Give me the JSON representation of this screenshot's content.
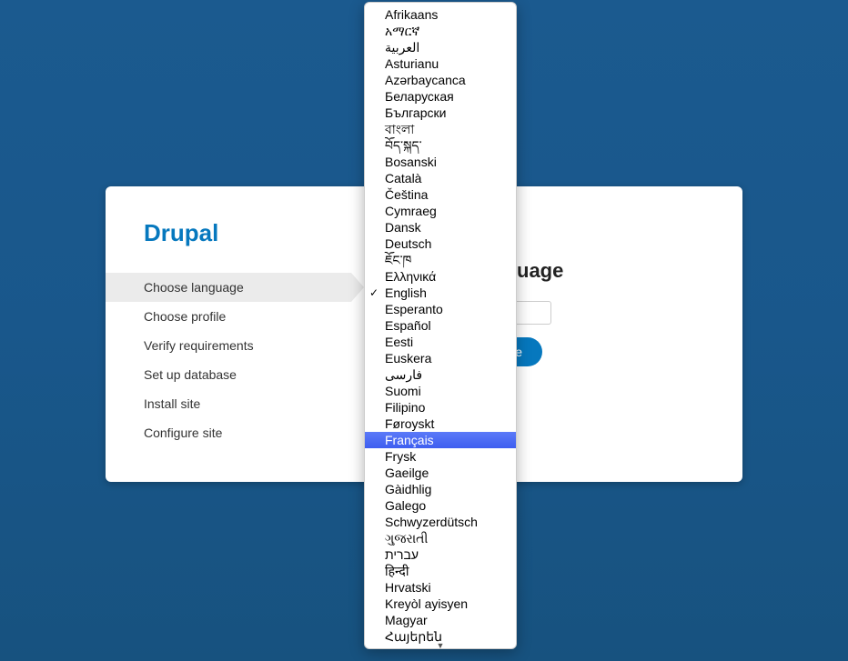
{
  "brand": "Drupal",
  "heading": "Choose language",
  "button_label": "Save and continue",
  "steps": [
    {
      "label": "Choose language",
      "active": true
    },
    {
      "label": "Choose profile",
      "active": false
    },
    {
      "label": "Verify requirements",
      "active": false
    },
    {
      "label": "Set up database",
      "active": false
    },
    {
      "label": "Install site",
      "active": false
    },
    {
      "label": "Configure site",
      "active": false
    }
  ],
  "dropdown": {
    "selected": "English",
    "highlighted": "Français",
    "options": [
      "Afrikaans",
      "አማርኛ",
      "العربية",
      "Asturianu",
      "Azərbaycanca",
      "Беларуская",
      "Български",
      "বাংলা",
      "བོད་སྐད་",
      "Bosanski",
      "Català",
      "Čeština",
      "Cymraeg",
      "Dansk",
      "Deutsch",
      "ཇོང་ཁ",
      "Ελληνικά",
      "English",
      "Esperanto",
      "Español",
      "Eesti",
      "Euskera",
      "فارسی",
      "Suomi",
      "Filipino",
      "Føroyskt",
      "Français",
      "Frysk",
      "Gaeilge",
      "Gàidhlig",
      "Galego",
      "Schwyzerdütsch",
      "ગુજરાતી",
      "עברית",
      "हिन्दी",
      "Hrvatski",
      "Kreyòl ayisyen",
      "Magyar",
      "Հայերեն"
    ]
  }
}
